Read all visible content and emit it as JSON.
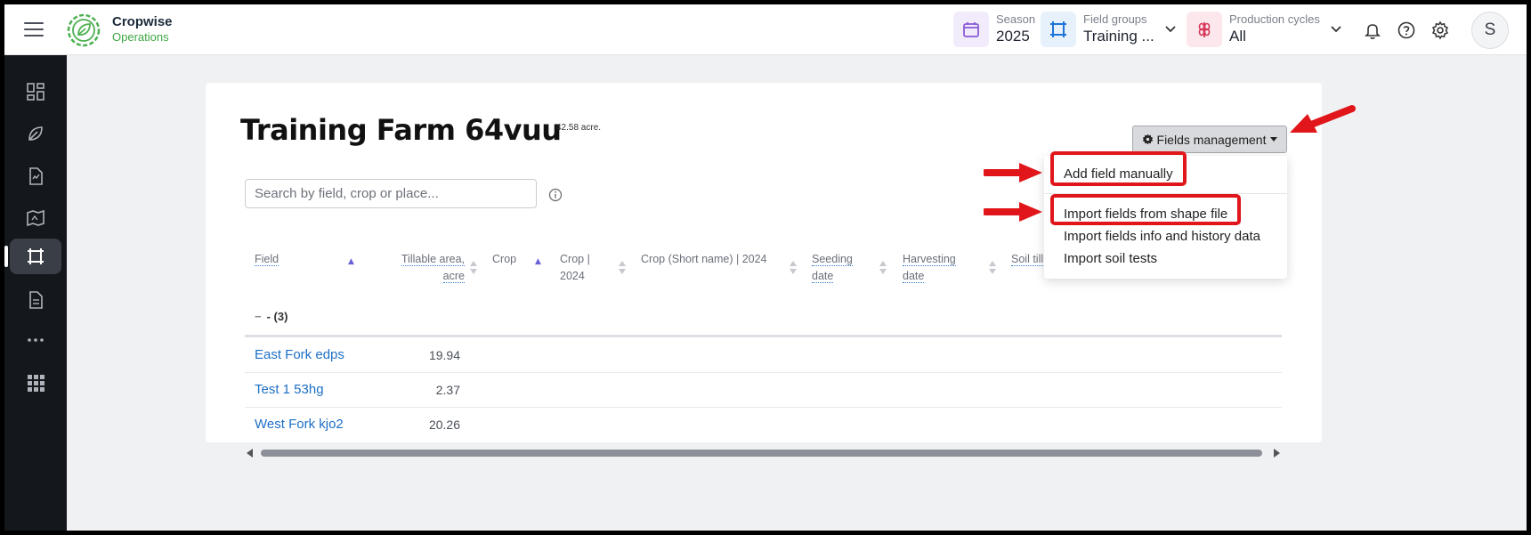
{
  "app": {
    "brand_line1": "Cropwise",
    "brand_line2": "Operations"
  },
  "header": {
    "season": {
      "label": "Season",
      "value": "2025"
    },
    "field_groups": {
      "label": "Field groups",
      "value": "Training ..."
    },
    "production_cycles": {
      "label": "Production cycles",
      "value": "All"
    },
    "avatar_initial": "S"
  },
  "sidebar": {
    "items": [
      {
        "icon": "dashboard-icon"
      },
      {
        "icon": "crop-leaf-icon"
      },
      {
        "icon": "document-chart-icon"
      },
      {
        "icon": "map-route-icon"
      },
      {
        "icon": "fields-icon",
        "active": true
      },
      {
        "icon": "report-document-icon"
      },
      {
        "icon": "more-dots-icon"
      },
      {
        "icon": "apps-grid-icon"
      }
    ]
  },
  "page": {
    "title": "Training Farm 64vuu",
    "area": "42.58 acre.",
    "search_placeholder": "Search by field, crop or place..."
  },
  "table": {
    "headers": {
      "field": "Field",
      "tillable_l1": "Tillable area,",
      "tillable_l2": "acre",
      "crop": "Crop",
      "crop2024_l1": "Crop |",
      "crop2024_l2": "2024",
      "crop_short": "Crop (Short name) | 2024",
      "seeding_l1": "Seeding",
      "seeding_l2": "date",
      "harvesting_l1": "Harvesting",
      "harvesting_l2": "date",
      "soil": "Soil till"
    },
    "group_label": "- (3)",
    "rows": [
      {
        "field": "East Fork edps",
        "area": "19.94"
      },
      {
        "field": "Test 1 53hg",
        "area": "2.37"
      },
      {
        "field": "West Fork kjo2",
        "area": "20.26"
      }
    ]
  },
  "fields_management": {
    "button_label": "Fields management",
    "menu": [
      "Add field manually",
      "Import fields from shape file",
      "Import fields info and history data",
      "Import soil tests"
    ]
  },
  "colors": {
    "annotation_red": "#e0161b",
    "link_blue": "#1d6fc5",
    "brand_green": "#3ea843"
  }
}
